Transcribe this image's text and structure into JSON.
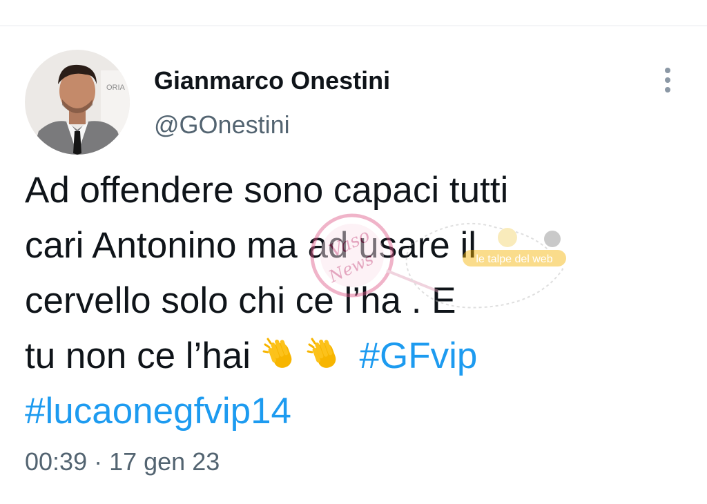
{
  "tweet": {
    "author": {
      "display_name": "Gianmarco Onestini",
      "handle": "@GOnestini"
    },
    "text_lines": [
      "Ad offendere sono capaci tutti",
      "cari Antonino ma ad usare il",
      "cervello solo chi ce l’ha . E"
    ],
    "line4_prefix": "tu non ce l’hai",
    "emoji": [
      "clapping-hands-emoji",
      "clapping-hands-emoji"
    ],
    "hashtags": [
      "#GFvip",
      "#lucaonegfvip14"
    ],
    "timestamp": "00:39 · 17 gen 23"
  },
  "colors": {
    "hashtag": "#1d9bf0",
    "text": "#0f1419",
    "secondary": "#536471"
  },
  "watermarks": {
    "left_logo_text": "Il Vaso delle News",
    "right_logo_text": "le talpe del web"
  },
  "icons": {
    "more": "more-vertical-icon"
  }
}
